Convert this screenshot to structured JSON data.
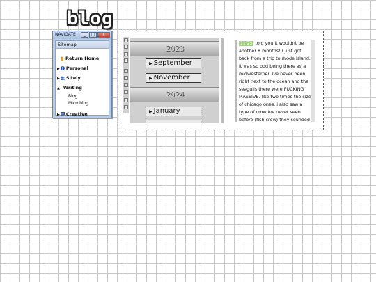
{
  "logo": {
    "text": "blog"
  },
  "navigate": {
    "title": "NAVIGATE",
    "controls": {
      "min": "_",
      "max": "□",
      "close": "x"
    },
    "sitemap_label": "Sitemap",
    "items": [
      {
        "label": "Return Home",
        "icon": "house-icon"
      },
      {
        "label": "Personal",
        "icon": "info-icon"
      },
      {
        "label": "Sitely",
        "icon": "people-icon"
      },
      {
        "label": "Writing",
        "icon": "none",
        "children": [
          "Blog",
          "Microblog"
        ]
      },
      {
        "label": "Creative",
        "icon": "monitor-icon"
      }
    ]
  },
  "archive": {
    "years": [
      "2023",
      "2024"
    ],
    "months_2023": [
      "September",
      "November"
    ],
    "months_2024": [
      "January",
      ""
    ]
  },
  "post": {
    "date": "11/25",
    "text": "told you it wouldnt be another 8 months! i just got back from a trip to rhode island. it was so odd being there as a midwesterner. ive never been right next to the ocean and the seagulls there were FUCKING MASSIVE. like two times the size of chicago ones. i also saw a type of crow ive never seen before (fish crow) they sounded so weird. the birds and the"
  },
  "colors": {
    "accent": "#9fcf7a",
    "window": "#b9cde6",
    "close": "#c4412d"
  }
}
